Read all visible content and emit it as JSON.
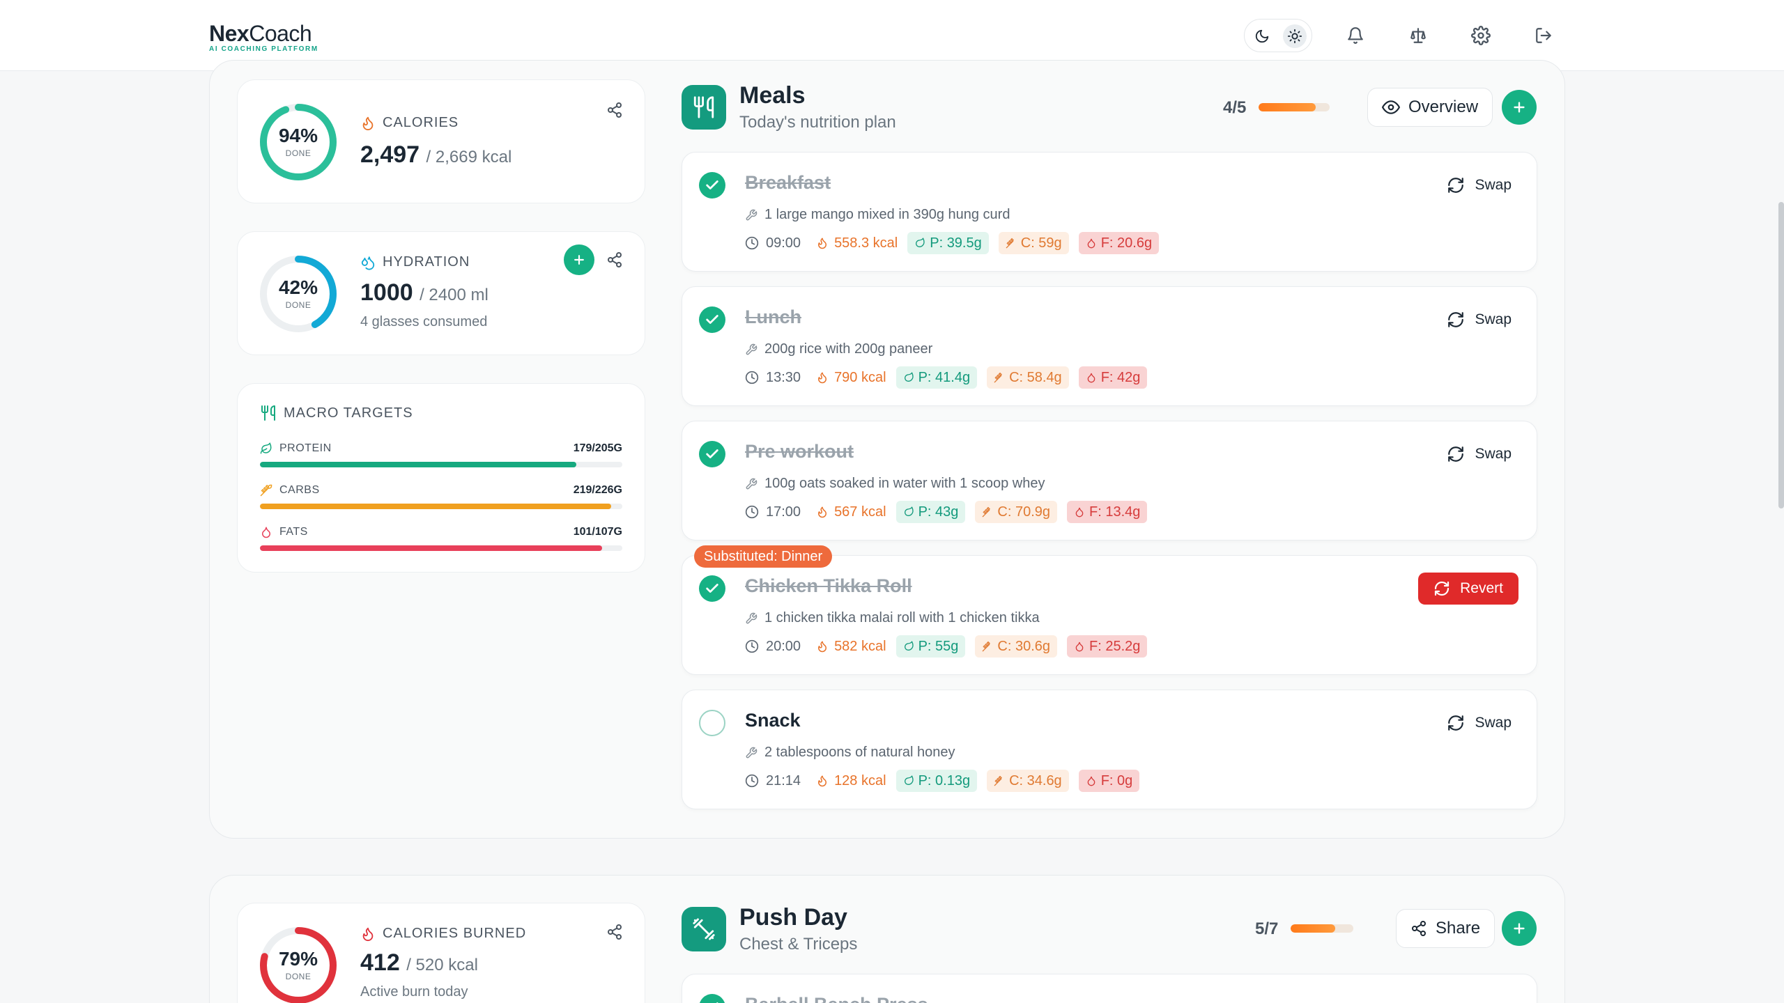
{
  "brand": {
    "name_bold": "Nex",
    "name_rest": "Coach",
    "tagline": "AI COACHING PLATFORM"
  },
  "topbar": {
    "icons": [
      "moon-icon",
      "sun-icon",
      "bell-icon",
      "scale-icon",
      "gear-icon",
      "logout-icon"
    ]
  },
  "calories": {
    "pct": "94%",
    "done": "DONE",
    "title": "CALORIES",
    "value": "2,497",
    "of": "/ 2,669 kcal",
    "progress": 0.94
  },
  "hydration": {
    "pct": "42%",
    "done": "DONE",
    "title": "HYDRATION",
    "value": "1000",
    "of": "/ 2400 ml",
    "sub": "4 glasses consumed",
    "progress": 0.42
  },
  "macros": {
    "title": "MACRO TARGETS",
    "items": [
      {
        "name": "PROTEIN",
        "value": "179/205G",
        "progress": 0.873,
        "color": "#16a97f"
      },
      {
        "name": "CARBS",
        "value": "219/226G",
        "progress": 0.969,
        "color": "#f0a020"
      },
      {
        "name": "FATS",
        "value": "101/107G",
        "progress": 0.944,
        "color": "#e8405a"
      }
    ]
  },
  "meals": {
    "title": "Meals",
    "subtitle": "Today's nutrition plan",
    "count": "4/5",
    "progress": 0.8,
    "overview_label": "Overview",
    "items": [
      {
        "name": "Breakfast",
        "done": true,
        "desc": "1 large mango mixed in 390g hung curd",
        "time": "09:00",
        "kcal": "558.3 kcal",
        "p": "P: 39.5g",
        "c": "C: 59g",
        "f": "F: 20.6g",
        "action": "Swap"
      },
      {
        "name": "Lunch",
        "done": true,
        "desc": "200g rice with 200g paneer",
        "time": "13:30",
        "kcal": "790 kcal",
        "p": "P: 41.4g",
        "c": "C: 58.4g",
        "f": "F: 42g",
        "action": "Swap"
      },
      {
        "name": "Pre workout",
        "done": true,
        "desc": "100g oats soaked in water with 1 scoop whey",
        "time": "17:00",
        "kcal": "567 kcal",
        "p": "P: 43g",
        "c": "C: 70.9g",
        "f": "F: 13.4g",
        "action": "Swap"
      },
      {
        "name": "Chicken Tikka Roll",
        "done": true,
        "badge": "Substituted: Dinner",
        "desc": "1 chicken tikka malai roll with 1 chicken tikka",
        "time": "20:00",
        "kcal": "582 kcal",
        "p": "P: 55g",
        "c": "C: 30.6g",
        "f": "F: 25.2g",
        "action": "Revert"
      },
      {
        "name": "Snack",
        "done": false,
        "desc": "2 tablespoons of natural honey",
        "time": "21:14",
        "kcal": "128 kcal",
        "p": "P: 0.13g",
        "c": "C: 34.6g",
        "f": "F: 0g",
        "action": "Swap"
      }
    ]
  },
  "burned": {
    "pct": "79%",
    "done": "DONE",
    "title": "CALORIES BURNED",
    "value": "412",
    "of": "/ 520 kcal",
    "sub": "Active burn today",
    "progress": 0.79
  },
  "workout": {
    "title": "Push Day",
    "subtitle": "Chest & Triceps",
    "count": "5/7",
    "progress": 0.714,
    "share_label": "Share",
    "next_item": "Barbell Bench Press"
  },
  "colors": {
    "accent": "#16b184",
    "orange": "#ff7a1a",
    "red": "#e02a2a",
    "teal_ring": "#2bbf9a",
    "blue_ring": "#12a9d6",
    "red_ring": "#e0323c"
  }
}
